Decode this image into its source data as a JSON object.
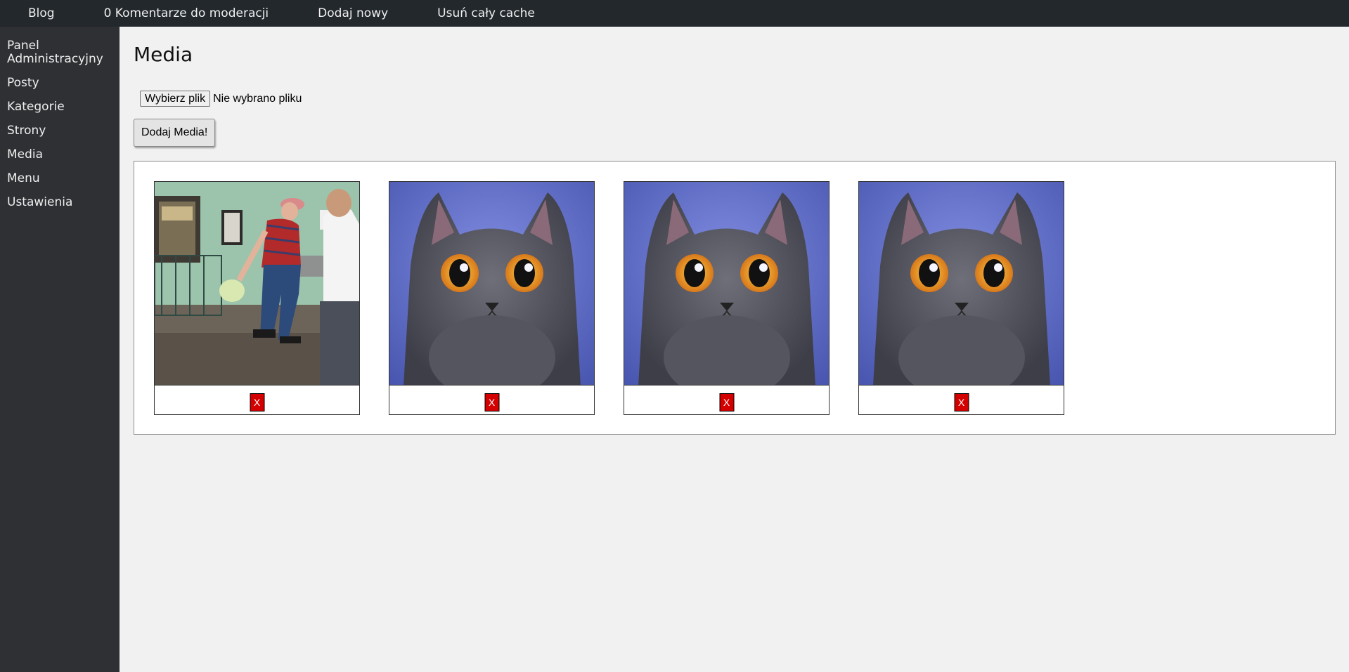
{
  "topbar": {
    "items": [
      {
        "label": "Blog"
      },
      {
        "label": "0 Komentarze do moderacji"
      },
      {
        "label": "Dodaj nowy"
      },
      {
        "label": "Usuń cały cache"
      }
    ]
  },
  "sidebar": {
    "items": [
      {
        "label": "Panel Administracyjny"
      },
      {
        "label": "Posty"
      },
      {
        "label": "Kategorie"
      },
      {
        "label": "Strony"
      },
      {
        "label": "Media"
      },
      {
        "label": "Menu"
      },
      {
        "label": "Ustawienia"
      }
    ]
  },
  "main": {
    "title": "Media",
    "file_input": {
      "button_label": "Wybierz plik",
      "status_text": "Nie wybrano pliku"
    },
    "submit_label": "Dodaj Media!",
    "media": [
      {
        "image": "photo-man-walking",
        "delete_label": "X"
      },
      {
        "image": "photo-grey-cat",
        "delete_label": "X"
      },
      {
        "image": "photo-grey-cat",
        "delete_label": "X"
      },
      {
        "image": "photo-grey-cat",
        "delete_label": "X"
      }
    ]
  },
  "colors": {
    "topbar_bg": "#23282d",
    "sidebar_bg": "#2e3033",
    "content_bg": "#f1f1f1",
    "delete_red": "#d40000"
  }
}
